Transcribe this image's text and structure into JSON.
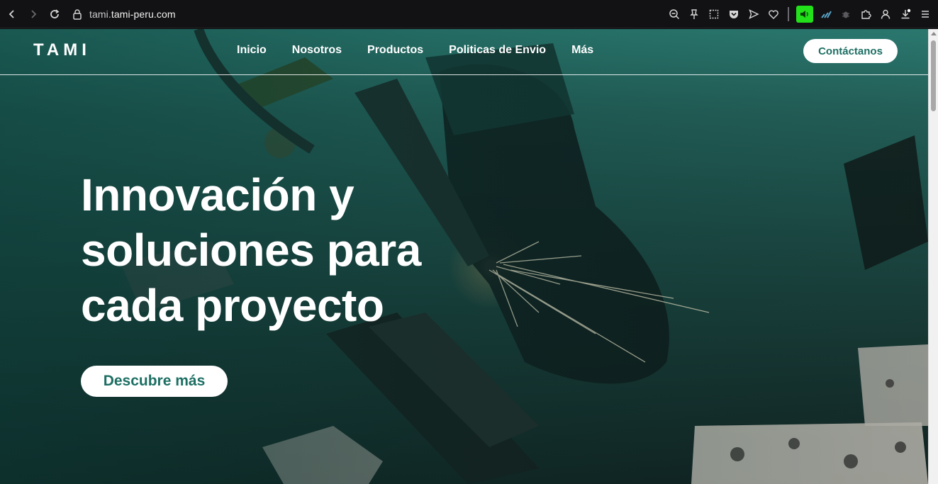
{
  "browser": {
    "url_prefix": "tami.",
    "url_domain": "tami-peru.com"
  },
  "site": {
    "logo": "TAMI",
    "nav": [
      {
        "label": "Inicio"
      },
      {
        "label": "Nosotros"
      },
      {
        "label": "Productos"
      },
      {
        "label": "Politicas de Envio"
      },
      {
        "label": "Más"
      }
    ],
    "contact_label": "Contáctanos"
  },
  "hero": {
    "title_line1": "Innovación y",
    "title_line2": "soluciones para",
    "title_line3": "cada proyecto",
    "button_label": "Descubre más"
  },
  "colors": {
    "accent": "#1d6f63",
    "hero_teal": "#2c7b72",
    "extension_green": "#22e01a"
  }
}
